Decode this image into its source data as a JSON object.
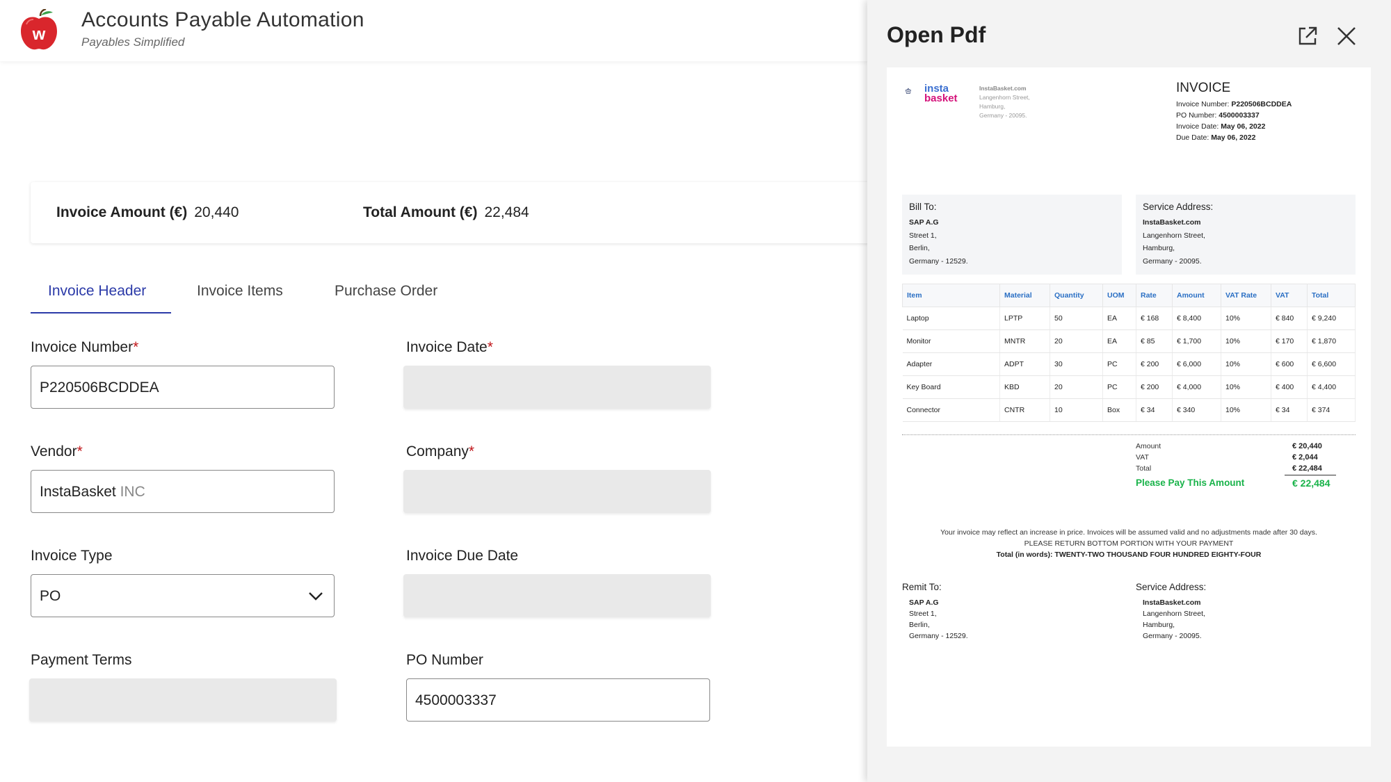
{
  "app": {
    "title": "Accounts Payable Automation",
    "subtitle": "Payables Simplified",
    "logo_letter": "w"
  },
  "amounts": {
    "invoice_amount_label": "Invoice Amount (€)",
    "invoice_amount_value": "20,440",
    "total_amount_label": "Total Amount (€)",
    "total_amount_value": "22,484"
  },
  "tabs": [
    {
      "label": "Invoice Header",
      "active": true
    },
    {
      "label": "Invoice Items",
      "active": false
    },
    {
      "label": "Purchase Order",
      "active": false
    }
  ],
  "form": {
    "invoice_number": {
      "label": "Invoice Number",
      "value": "P220506BCDDEA"
    },
    "invoice_date": {
      "label": "Invoice Date",
      "value": ""
    },
    "vendor": {
      "label": "Vendor",
      "value": "InstaBasket",
      "value_suffix": "INC"
    },
    "company": {
      "label": "Company",
      "value": ""
    },
    "invoice_type": {
      "label": "Invoice Type",
      "value": "PO"
    },
    "invoice_due_date": {
      "label": "Invoice Due Date",
      "value": ""
    },
    "payment_terms": {
      "label": "Payment Terms",
      "value": ""
    },
    "po_number": {
      "label": "PO Number",
      "value": "4500003337"
    },
    "required_mark": "*"
  },
  "pdf": {
    "title": "Open Pdf",
    "brand_top": "insta",
    "brand_bottom": "basket",
    "company_address": [
      "InstaBasket.com",
      "Langenhorn Street,",
      "Hamburg,",
      "Germany - 20095."
    ],
    "invoice_title": "INVOICE",
    "meta": [
      {
        "label": "Invoice Number:",
        "value": "P220506BCDDEA"
      },
      {
        "label": "PO Number:",
        "value": "4500003337"
      },
      {
        "label": "Invoice Date:",
        "value": "May 06, 2022"
      },
      {
        "label": "Due Date:",
        "value": "May 06, 2022"
      }
    ],
    "bill_to": {
      "heading": "Bill To:",
      "lines": [
        "SAP A.G",
        "Street 1,",
        "Berlin,",
        "Germany - 12529."
      ]
    },
    "service_address": {
      "heading": "Service Address:",
      "lines": [
        "InstaBasket.com",
        "Langenhorn Street,",
        "Hamburg,",
        "Germany - 20095."
      ]
    },
    "table_headers": [
      "Item",
      "Material",
      "Quantity",
      "UOM",
      "Rate",
      "Amount",
      "VAT Rate",
      "VAT",
      "Total"
    ],
    "table_rows": [
      [
        "Laptop",
        "LPTP",
        "50",
        "EA",
        "€ 168",
        "€ 8,400",
        "10%",
        "€ 840",
        "€ 9,240"
      ],
      [
        "Monitor",
        "MNTR",
        "20",
        "EA",
        "€ 85",
        "€ 1,700",
        "10%",
        "€ 170",
        "€ 1,870"
      ],
      [
        "Adapter",
        "ADPT",
        "30",
        "PC",
        "€ 200",
        "€ 6,000",
        "10%",
        "€ 600",
        "€ 6,600"
      ],
      [
        "Key Board",
        "KBD",
        "20",
        "PC",
        "€ 200",
        "€ 4,000",
        "10%",
        "€ 400",
        "€ 4,400"
      ],
      [
        "Connector",
        "CNTR",
        "10",
        "Box",
        "€ 34",
        "€ 340",
        "10%",
        "€ 34",
        "€ 374"
      ]
    ],
    "totals": {
      "amount_label": "Amount",
      "amount_value": "€ 20,440",
      "vat_label": "VAT",
      "vat_value": "€ 2,044",
      "total_label": "Total",
      "total_value": "€ 22,484",
      "pay_label": "Please Pay This Amount",
      "pay_value": "€ 22,484"
    },
    "note_line1": "Your invoice may reflect an increase in price. Invoices will be assumed valid and no adjustments made after 30 days.",
    "note_line2": "PLEASE RETURN BOTTOM PORTION WITH YOUR PAYMENT",
    "note_line3": "Total (in words): TWENTY-TWO THOUSAND FOUR HUNDRED EIGHTY-FOUR",
    "remit_to": {
      "heading": "Remit To:",
      "lines": [
        "SAP A.G",
        "Street 1,",
        "Berlin,",
        "Germany - 12529."
      ]
    },
    "remit_service": {
      "heading": "Service Address:",
      "lines": [
        "InstaBasket.com",
        "Langenhorn Street,",
        "Hamburg,",
        "Germany - 20095."
      ]
    }
  },
  "colors": {
    "accent": "#2b3aa8",
    "required": "#c0161a",
    "table_header": "#2a6fc4",
    "pay_green": "#19b34a",
    "logo_red": "#d9262c"
  }
}
